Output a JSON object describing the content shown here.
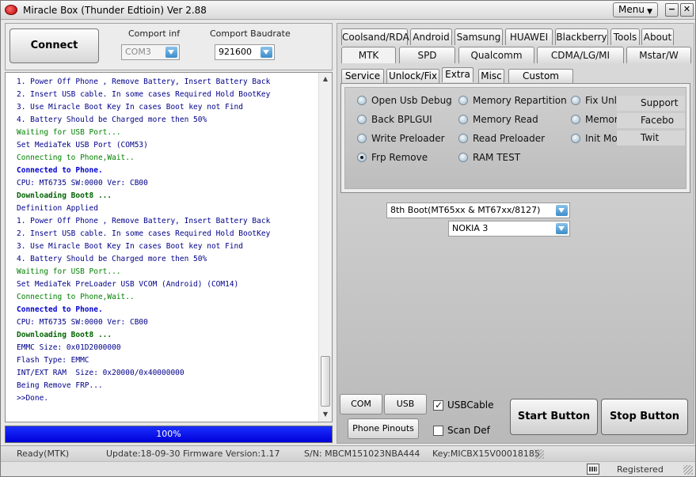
{
  "window": {
    "title": "Miracle Box (Thunder Edtioin) Ver 2.88",
    "menu_label": "Menu",
    "minimize_glyph": "−",
    "maximize_glyph": "□",
    "close_glyph": "✕"
  },
  "connection": {
    "connect_label": "Connect Button",
    "comport_label": "Comport inf",
    "comport_value": "COM3",
    "baud_label": "Comport Baudrate",
    "baud_value": "921600"
  },
  "log": [
    {
      "text": "1. Power Off Phone , Remove Battery, Insert Battery Back",
      "color": "#00008b",
      "bold": false
    },
    {
      "text": "2. Insert USB cable. In some cases Required Hold BootKey",
      "color": "#00008b",
      "bold": false
    },
    {
      "text": "3. Use Miracle Boot Key In cases Boot key not Find",
      "color": "#00008b",
      "bold": false
    },
    {
      "text": "4. Battery Should be Charged more then 50%",
      "color": "#00008b",
      "bold": false
    },
    {
      "text": "Waiting for USB Port...",
      "color": "#008000",
      "bold": false
    },
    {
      "text": "Set MediaTek USB Port (COM53)",
      "color": "#00008b",
      "bold": false
    },
    {
      "text": "Connecting to Phone,Wait..",
      "color": "#008000",
      "bold": false
    },
    {
      "text": "Connected to Phone.",
      "color": "#0000cd",
      "bold": true
    },
    {
      "text": "CPU: MT6735 SW:0000 Ver: CB00",
      "color": "#00008b",
      "bold": false
    },
    {
      "text": "Downloading Boot8 ...",
      "color": "#006400",
      "bold": true
    },
    {
      "text": "Definition Applied",
      "color": "#00008b",
      "bold": false
    },
    {
      "text": "1. Power Off Phone , Remove Battery, Insert Battery Back",
      "color": "#00008b",
      "bold": false
    },
    {
      "text": "2. Insert USB cable. In some cases Required Hold BootKey",
      "color": "#00008b",
      "bold": false
    },
    {
      "text": "3. Use Miracle Boot Key In cases Boot key not Find",
      "color": "#00008b",
      "bold": false
    },
    {
      "text": "4. Battery Should be Charged more then 50%",
      "color": "#00008b",
      "bold": false
    },
    {
      "text": "Waiting for USB Port...",
      "color": "#008000",
      "bold": false
    },
    {
      "text": "Set MediaTek PreLoader USB VCOM (Android) (COM14)",
      "color": "#00008b",
      "bold": false
    },
    {
      "text": "Connecting to Phone,Wait..",
      "color": "#008000",
      "bold": false
    },
    {
      "text": "Connected to Phone.",
      "color": "#0000cd",
      "bold": true
    },
    {
      "text": "CPU: MT6735 SW:0000 Ver: CB00",
      "color": "#00008b",
      "bold": false
    },
    {
      "text": "Downloading Boot8 ...",
      "color": "#006400",
      "bold": true
    },
    {
      "text": "EMMC Size: 0x01D2000000",
      "color": "#00008b",
      "bold": false
    },
    {
      "text": "Flash Type: EMMC",
      "color": "#00008b",
      "bold": false
    },
    {
      "text": "INT/EXT RAM  Size: 0x20000/0x40000000",
      "color": "#00008b",
      "bold": false
    },
    {
      "text": "Being Remove FRP...",
      "color": "#00008b",
      "bold": false
    },
    {
      "text": ">>Done.",
      "color": "#00008b",
      "bold": false
    }
  ],
  "progress": {
    "percent_label": "100%",
    "fraction": 1.0
  },
  "tabs_row1": [
    "Coolsand/RDA",
    "Android",
    "Samsung",
    "HUAWEI",
    "Blackberry",
    "Tools",
    "About"
  ],
  "tabs_row2": [
    "MTK",
    "SPD",
    "Qualcomm",
    "CDMA/LG/MI",
    "Mstar/W"
  ],
  "active_tab": "MTK",
  "subtabs": [
    "Service",
    "Unlock/Fix",
    "Extra",
    "Misc",
    "Custom Setting"
  ],
  "active_subtab": "Extra",
  "options": {
    "col1": [
      {
        "label": "Open Usb Debug",
        "checked": false
      },
      {
        "label": "Back BPLGUI",
        "checked": false
      },
      {
        "label": "Write Preloader",
        "checked": false
      },
      {
        "label": "Frp Remove",
        "checked": true
      }
    ],
    "col2": [
      {
        "label": "Memory Repartition",
        "checked": false
      },
      {
        "label": "Memory Read",
        "checked": false
      },
      {
        "label": "Read Preloader",
        "checked": false
      },
      {
        "label": "RAM TEST",
        "checked": false
      }
    ],
    "col3": [
      {
        "label": "Fix Unl",
        "checked": false
      },
      {
        "label": "Memor",
        "checked": false
      },
      {
        "label": "Init Mo",
        "checked": false
      }
    ],
    "side_links": [
      "Support",
      "Facebo",
      "Twit"
    ]
  },
  "boot_select": "8th Boot(MT65xx & MT67xx/8127)",
  "model_select": "NOKIA 3",
  "bottom": {
    "com_scan": "COM Scan",
    "usb_scan": "USB Scan",
    "phone_pinouts": "Phone Pinouts",
    "usb_cable_label": "USBCable",
    "usb_cable_checked": true,
    "scan_def_label": "Scan Def",
    "scan_def_checked": false,
    "start_label": "Start Button",
    "stop_label": "Stop Button"
  },
  "status": {
    "state": "Ready(MTK)",
    "update": "Update:18-09-30",
    "firmware": "Firmware Version:1.17",
    "serial": "S/N: MBCM151023NBA444",
    "key": "Key:MICBX15V00018185",
    "registered": "Registered"
  }
}
